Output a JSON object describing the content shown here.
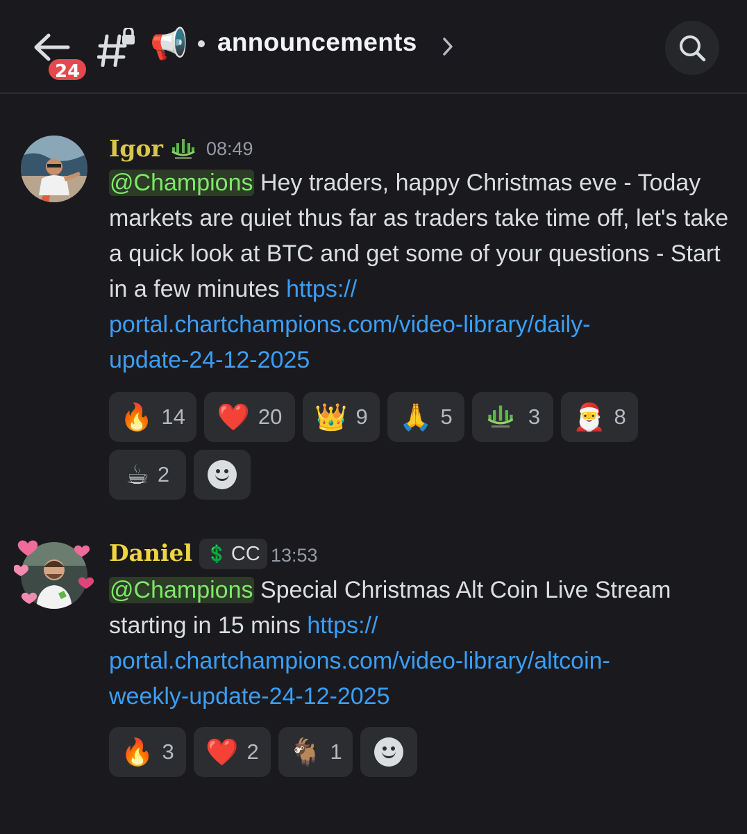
{
  "header": {
    "back_badge": "24",
    "channel_name": "announcements",
    "megaphone_emoji": "📢"
  },
  "messages": [
    {
      "author": "Igor",
      "author_color": "#d8c64a",
      "time": "08:49",
      "mention": "@Champions",
      "text": "Hey traders, happy Christmas eve - Today markets are quiet thus far as traders take time off, let's take a quick look at BTC and get some of your questions - Start in a few minutes",
      "link": "https://portal.chartchampions.com/video-library/daily-update-24-12-2025",
      "link_lines": [
        "https://",
        "portal.chartchampions.com/video-library/daily-",
        "update-24-12-2025"
      ],
      "reactions": [
        {
          "emoji": "🔥",
          "count": "14",
          "icon": "fire-icon"
        },
        {
          "emoji": "❤️",
          "count": "20",
          "icon": "heart-icon"
        },
        {
          "emoji": "👑",
          "count": "9",
          "icon": "crown-icon"
        },
        {
          "emoji": "🙏",
          "count": "5",
          "icon": "pray-icon"
        },
        {
          "emoji": "",
          "count": "3",
          "icon": "chartchampions-logo-icon"
        },
        {
          "emoji": "🎅",
          "count": "8",
          "icon": "santa-icon"
        },
        {
          "emoji": "☕",
          "count": "2",
          "icon": "coffee-icon"
        }
      ]
    },
    {
      "author": "Daniel",
      "author_color": "#f0d542",
      "role_tag": "CC",
      "time": "13:53",
      "mention": "@Champions",
      "text": "Special Christmas Alt Coin Live Stream starting in 15 mins",
      "link": "https://portal.chartchampions.com/video-library/altcoin-weekly-update-24-12-2025",
      "link_lines": [
        "https://",
        "portal.chartchampions.com/video-library/altcoin-",
        "weekly-update-24-12-2025"
      ],
      "reactions": [
        {
          "emoji": "🔥",
          "count": "3",
          "icon": "fire-icon"
        },
        {
          "emoji": "❤️",
          "count": "2",
          "icon": "heart-icon"
        },
        {
          "emoji": "🐐",
          "count": "1",
          "icon": "goat-icon"
        }
      ]
    }
  ],
  "colors": {
    "background": "#1a1a1e",
    "mention_text": "#7ee86a",
    "link": "#3b9ef5",
    "badge": "#e5484d",
    "reaction_bg": "#2b2d31"
  }
}
